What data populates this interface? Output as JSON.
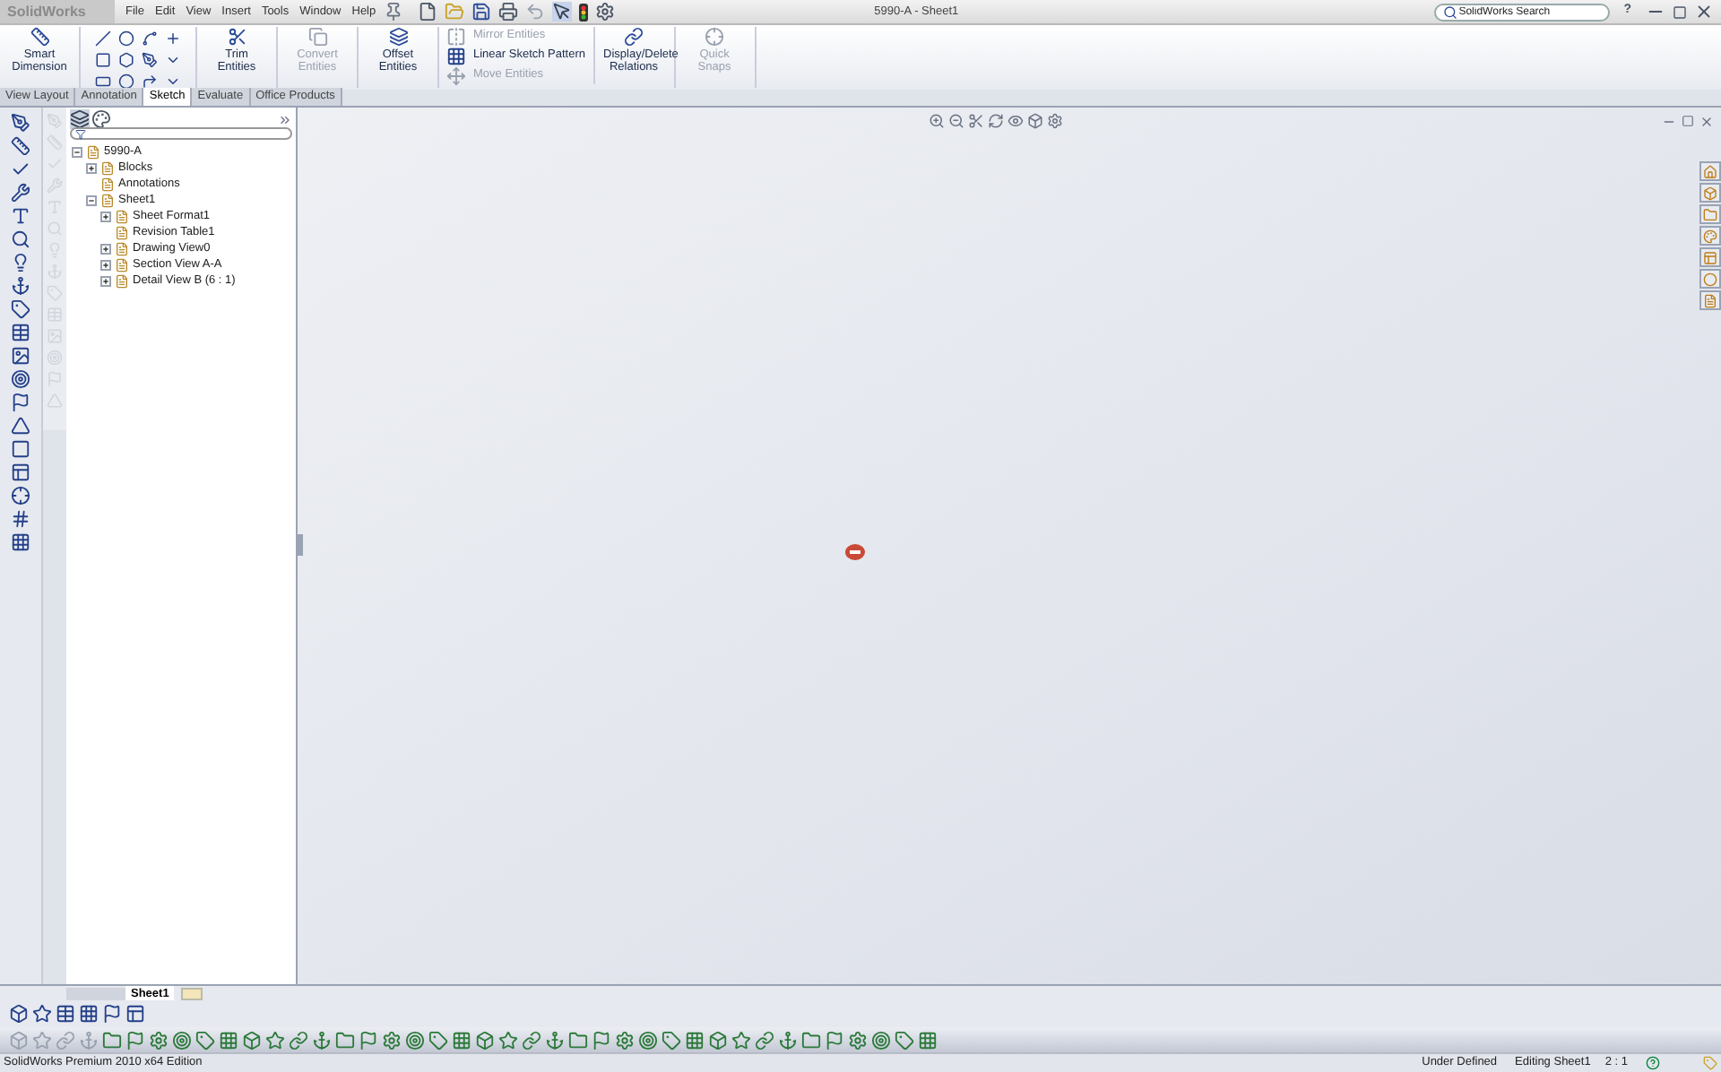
{
  "app": {
    "logo": "SolidWorks",
    "menu": [
      "File",
      "Edit",
      "View",
      "Insert",
      "Tools",
      "Window",
      "Help"
    ],
    "title": "5990-A - Sheet1",
    "search": {
      "placeholder": "SolidWorks Search"
    },
    "help": "?"
  },
  "ribbon": {
    "groups": [
      {
        "kind": "big",
        "label": "Smart Dimension",
        "disabled": false
      },
      {
        "kind": "sketch"
      },
      {
        "kind": "big",
        "label": "Trim Entities",
        "disabled": false
      },
      {
        "kind": "big",
        "label": "Convert Entities",
        "disabled": true
      },
      {
        "kind": "big",
        "label": "Offset Entities",
        "disabled": false
      },
      {
        "kind": "stack",
        "items": [
          {
            "label": "Mirror Entities",
            "disabled": true
          },
          {
            "label": "Linear Sketch Pattern",
            "disabled": false
          },
          {
            "label": "Move Entities",
            "disabled": true
          }
        ]
      },
      {
        "kind": "big",
        "label": "Display/Delete Relations",
        "disabled": false
      },
      {
        "kind": "big",
        "label": "Quick Snaps",
        "disabled": true
      }
    ]
  },
  "tabs": [
    {
      "label": "View Layout",
      "selected": false
    },
    {
      "label": "Annotation",
      "selected": false
    },
    {
      "label": "Sketch",
      "selected": true
    },
    {
      "label": "Evaluate",
      "selected": false
    },
    {
      "label": "Office Products",
      "selected": false
    }
  ],
  "tree": [
    {
      "label": "5990-A",
      "expanded": true,
      "children": [
        {
          "label": "Blocks",
          "expanded": false
        },
        {
          "label": "Annotations"
        },
        {
          "label": "Sheet1",
          "expanded": true,
          "children": [
            {
              "label": "Sheet Format1",
              "expanded": false
            },
            {
              "label": "Revision Table1"
            },
            {
              "label": "Drawing View0",
              "expanded": false
            },
            {
              "label": "Section View A-A",
              "expanded": false
            },
            {
              "label": "Detail View B (6 : 1)",
              "expanded": false
            }
          ]
        }
      ]
    }
  ],
  "sheet_tabs": [
    {
      "label": "Sheet1",
      "selected": true
    }
  ],
  "status_bar": {
    "edition": "SolidWorks Premium 2010 x64 Edition",
    "state": "Under Defined",
    "editing": "Editing Sheet1",
    "scale": "2 : 1"
  }
}
